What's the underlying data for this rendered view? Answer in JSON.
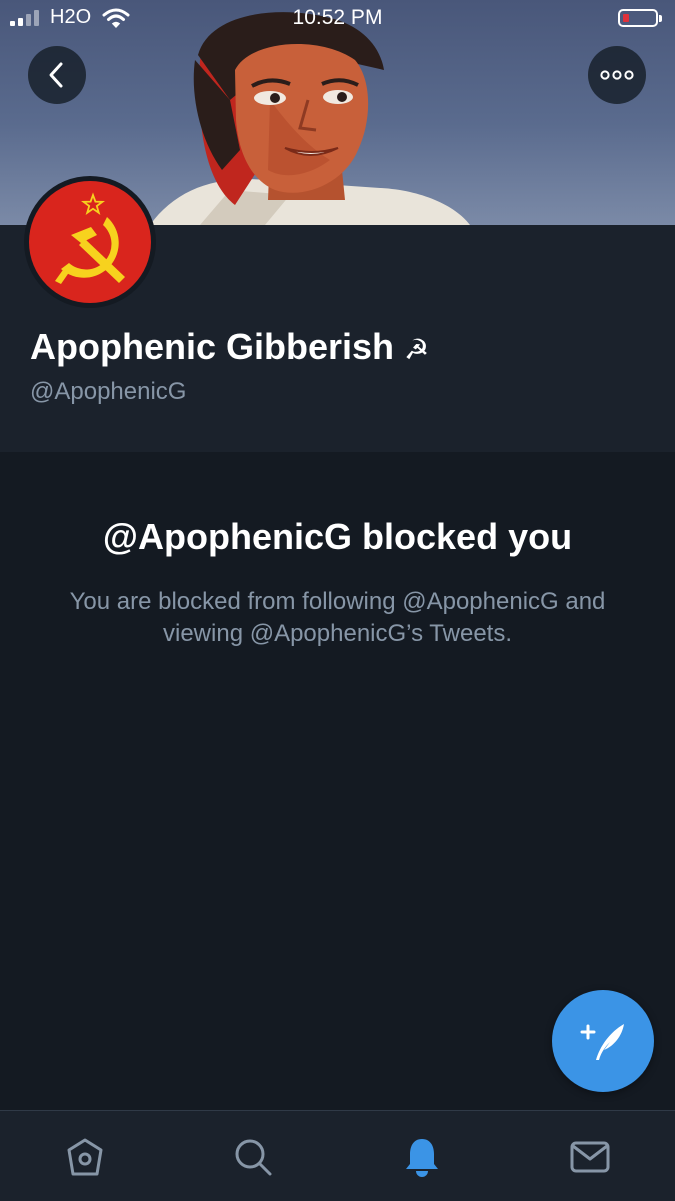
{
  "status_bar": {
    "carrier": "H2O",
    "time": "10:52 PM"
  },
  "profile": {
    "display_name": "Apophenic Gibberish",
    "name_emoji": "☭",
    "handle": "@ApophenicG"
  },
  "blocked": {
    "title": "@ApophenicG blocked you",
    "description": "You are blocked from following @ApophenicG and viewing @ApophenicG’s Tweets."
  },
  "icons": {
    "back": "chevron-left-icon",
    "more": "more-dots-icon",
    "compose": "compose-tweet-icon",
    "tabs": [
      "home-icon",
      "search-icon",
      "bell-icon",
      "mail-icon"
    ]
  },
  "tabs": {
    "active": "notifications"
  },
  "colors": {
    "background": "#141a22",
    "panel": "#1b222c",
    "accent": "#3b94e6",
    "secondary_text": "#8796a7",
    "avatar_red": "#d9251d",
    "hammer_sickle_yellow": "#f7d21e"
  }
}
